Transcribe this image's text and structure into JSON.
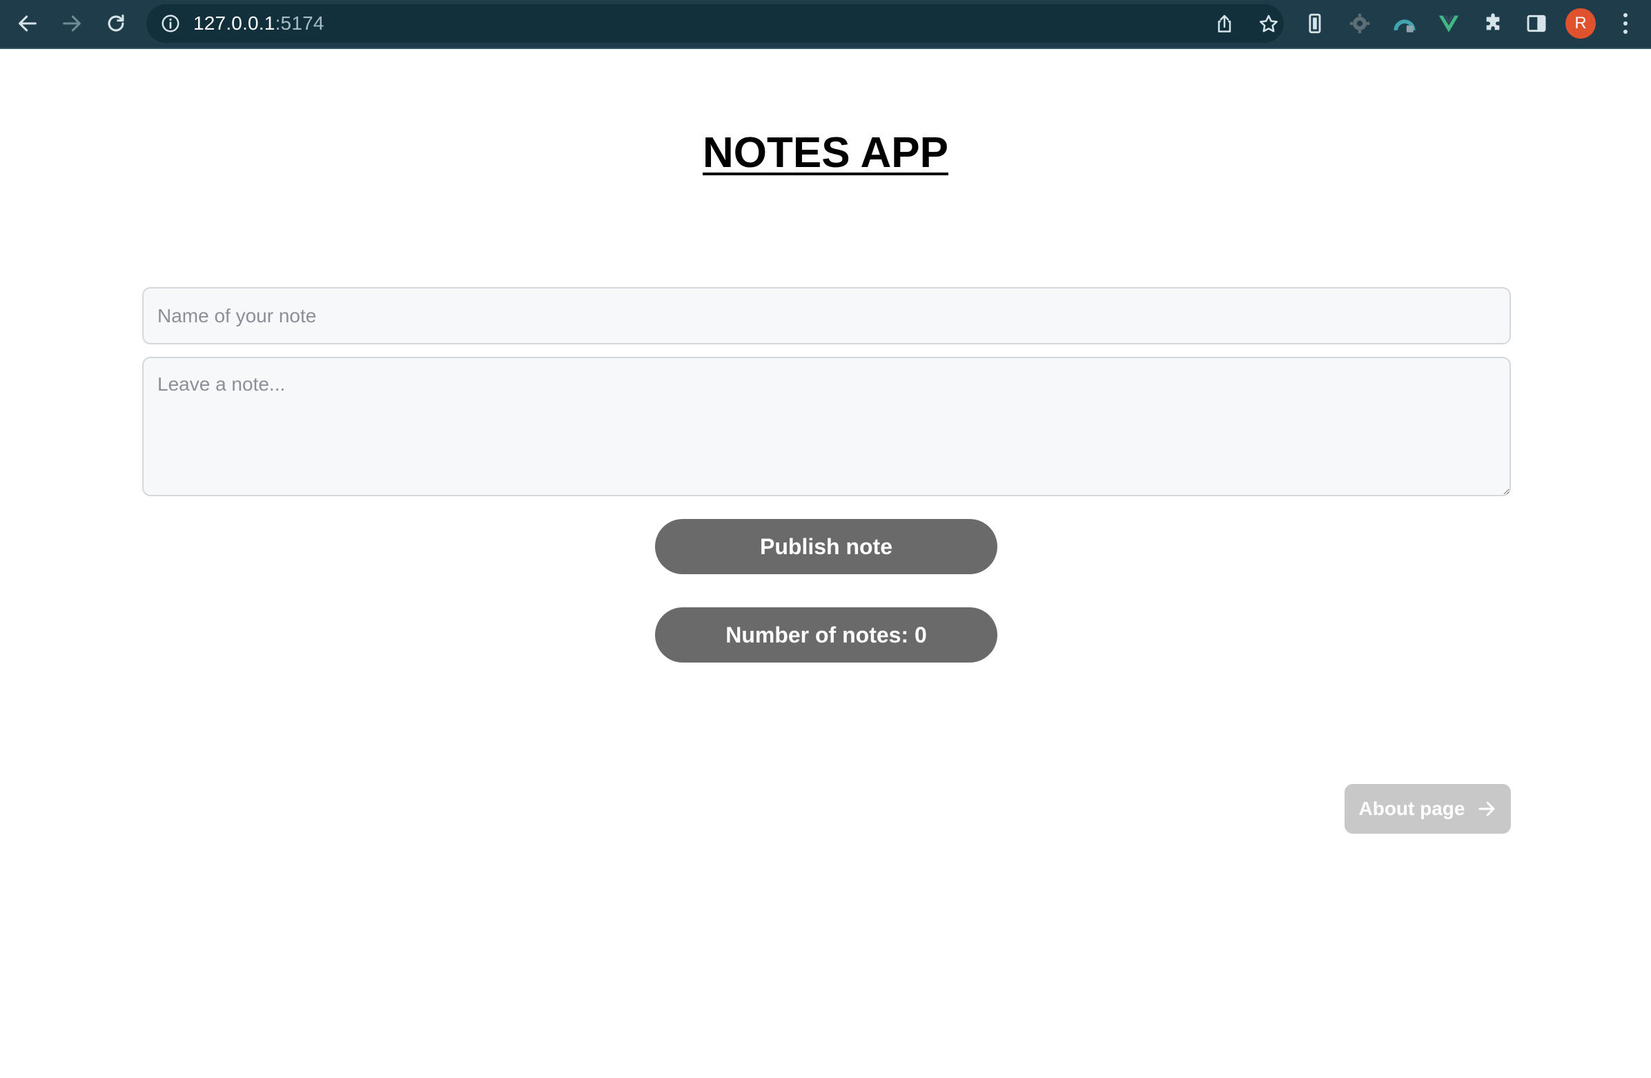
{
  "browser": {
    "url_host": "127.0.0.1",
    "url_port": ":5174",
    "back_icon": "back-arrow-icon",
    "forward_icon": "forward-arrow-icon",
    "reload_icon": "reload-icon",
    "site_info_icon": "info-icon",
    "share_icon": "share-icon",
    "bookmark_icon": "star-icon",
    "extensions": [
      "phone-frame-icon",
      "gear-extension-icon",
      "arc-extension-icon",
      "vue-devtools-icon",
      "puzzle-icon",
      "side-panel-icon"
    ],
    "profile_initial": "R",
    "profile_color": "#e0522d",
    "menu_icon": "more-vert-icon"
  },
  "main": {
    "title": "NOTES APP",
    "name_placeholder": "Name of your note",
    "note_placeholder": "Leave a note...",
    "publish_label": "Publish note",
    "count_label": "Number of notes: 0",
    "about_label": "About page",
    "about_icon": "arrow-right-icon"
  },
  "colors": {
    "chrome_bg": "#1f3c4a",
    "button_bg": "#6a6a6a",
    "about_bg": "#c8c8c8"
  }
}
